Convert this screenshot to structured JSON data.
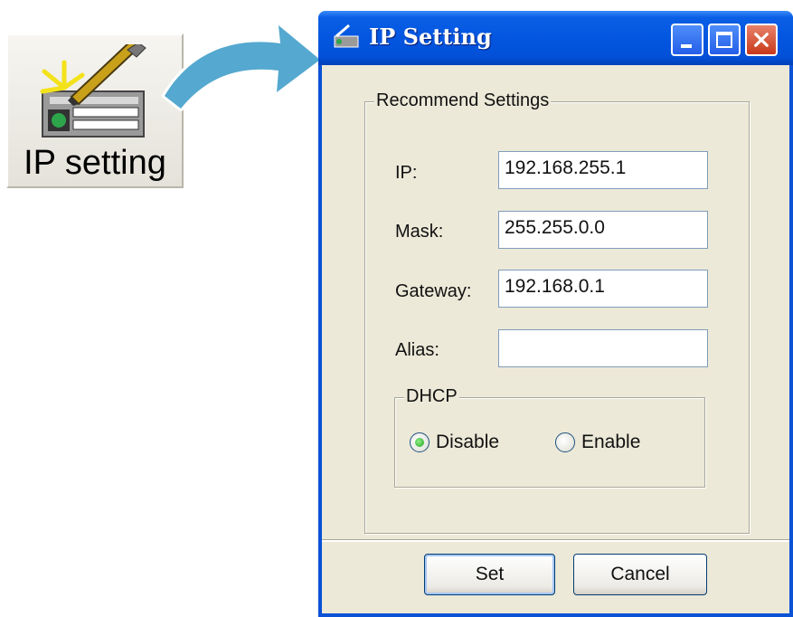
{
  "launcher": {
    "label": "IP setting",
    "icon": "ip-setting-icon"
  },
  "window": {
    "title": "IP Setting",
    "controls": [
      "minimize",
      "maximize",
      "close"
    ]
  },
  "recommend": {
    "legend": "Recommend Settings",
    "fields": [
      {
        "label": "IP:",
        "value": "192.168.255.1"
      },
      {
        "label": "Mask:",
        "value": "255.255.0.0"
      },
      {
        "label": "Gateway:",
        "value": "192.168.0.1"
      },
      {
        "label": "Alias:",
        "value": ""
      }
    ],
    "dhcp": {
      "legend": "DHCP",
      "options": [
        {
          "label": "Disable",
          "selected": true
        },
        {
          "label": "Enable",
          "selected": false
        }
      ]
    }
  },
  "buttons": {
    "set": "Set",
    "cancel": "Cancel"
  },
  "colors": {
    "titlebar": "#0356e0",
    "close": "#c9391a",
    "face": "#ece9d8",
    "arrow": "#4fa3c8"
  }
}
